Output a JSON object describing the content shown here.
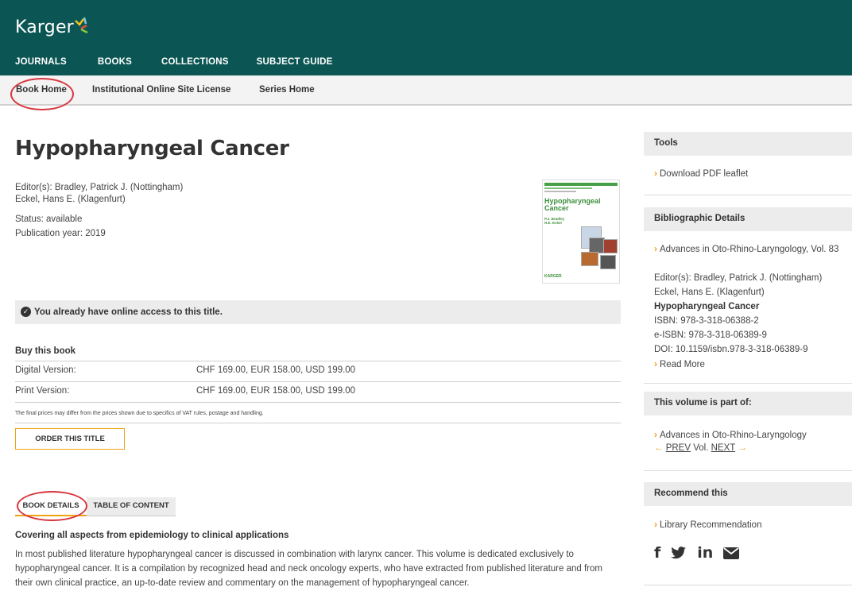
{
  "brand": {
    "logo_text": "Karger"
  },
  "topnav": [
    "JOURNALS",
    "BOOKS",
    "COLLECTIONS",
    "SUBJECT GUIDE"
  ],
  "subnav": [
    "Book Home",
    "Institutional Online Site License",
    "Series Home"
  ],
  "book": {
    "title": "Hypopharyngeal Cancer",
    "editors_line1": "Editor(s): Bradley, Patrick J. (Nottingham)",
    "editors_line2": "Eckel, Hans E. (Klagenfurt)",
    "status": "Status: available",
    "year": "Publication year: 2019"
  },
  "cover": {
    "title_line1": "Hypopharyngeal",
    "title_line2": "Cancer",
    "editors_line1": "P.J. Bradley",
    "editors_line2": "H.E. Eckel",
    "publisher": "KARGER"
  },
  "access_msg": "You already have online access to this title.",
  "buy": {
    "heading": "Buy this book",
    "rows": [
      {
        "label": "Digital Version:",
        "price": "CHF 169.00, EUR 158.00, USD 199.00"
      },
      {
        "label": "Print Version:",
        "price": "CHF 169.00, EUR 158.00, USD 199.00"
      }
    ],
    "fine_print": "The final prices may differ from the prices shown due to specifics of VAT rules, postage and handling.",
    "order_button": "ORDER THIS TITLE"
  },
  "tabs": [
    "BOOK DETAILS",
    "TABLE OF CONTENT"
  ],
  "details": {
    "heading": "Covering all aspects from epidemiology to clinical applications",
    "text": "In most published literature hypopharyngeal cancer is discussed in combination with larynx cancer. This volume is dedicated exclusively to hypopharyngeal cancer. It is a compilation by recognized head and neck oncology experts, who have extracted from published literature and from their own clinical practice, an up-to-date review and commentary on the management of hypopharyngeal cancer."
  },
  "sidebar": {
    "tools": {
      "heading": "Tools",
      "link": "Download PDF leaflet"
    },
    "biblio": {
      "heading": "Bibliographic Details",
      "series_link": "Advances in Oto-Rhino-Laryngology, Vol. 83",
      "editors_line1": "Editor(s): Bradley, Patrick J. (Nottingham)",
      "editors_line2": "Eckel, Hans E. (Klagenfurt)",
      "title": "Hypopharyngeal Cancer",
      "isbn": "ISBN: 978-3-318-06388-2",
      "eisbn": "e-ISBN: 978-3-318-06389-9",
      "doi": "DOI: 10.1159/isbn.978-3-318-06389-9",
      "read_more": "Read More"
    },
    "volume": {
      "heading": "This volume is part of:",
      "series_link": "Advances in Oto-Rhino-Laryngology",
      "prev": "PREV",
      "vol": "Vol.",
      "next": "NEXT"
    },
    "recommend": {
      "heading": "Recommend this",
      "link": "Library Recommendation",
      "social": [
        "facebook-icon",
        "twitter-icon",
        "linkedin-icon",
        "email-icon"
      ]
    }
  },
  "colors": {
    "header_bg": "#0b5654",
    "accent_orange": "#f0a20f",
    "annotation_red": "#d9363e"
  }
}
